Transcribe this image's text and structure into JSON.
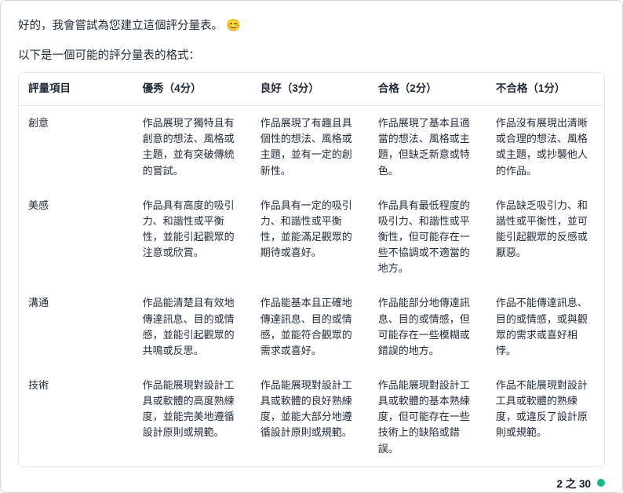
{
  "intro": "好的，我會嘗試為您建立這個評分量表。",
  "intro_emoji": "😊",
  "subtitle": "以下是一個可能的評分量表的格式：",
  "table": {
    "headers": {
      "item": "評量項目",
      "l4": "優秀（4分）",
      "l3": "良好（3分）",
      "l2": "合格（2分）",
      "l1": "不合格（1分）"
    },
    "rows": [
      {
        "name": "創意",
        "l4": "作品展現了獨特且有創意的想法、風格或主題，並有突破傳統的嘗試。",
        "l3": "作品展現了有趣且具個性的想法、風格或主題，並有一定的創新性。",
        "l2": "作品展現了基本且適當的想法、風格或主題，但缺乏新意或特色。",
        "l1": "作品沒有展現出清晰或合理的想法、風格或主題，或抄襲他人的作品。"
      },
      {
        "name": "美感",
        "l4": "作品具有高度的吸引力、和諧性或平衡性，並能引起觀眾的注意或欣賞。",
        "l3": "作品具有一定的吸引力、和諧性或平衡性，並能滿足觀眾的期待或喜好。",
        "l2": "作品具有最低程度的吸引力、和諧性或平衡性，但可能存在一些不協調或不適當的地方。",
        "l1": "作品缺乏吸引力、和諧性或平衡性，並可能引起觀眾的反感或厭惡。"
      },
      {
        "name": "溝通",
        "l4": "作品能清楚且有效地傳達訊息、目的或情感，並能引起觀眾的共鳴或反思。",
        "l3": "作品能基本且正確地傳達訊息、目的或情感，並能符合觀眾的需求或喜好。",
        "l2": "作品能部分地傳達訊息、目的或情感，但可能存在一些模糊或錯誤的地方。",
        "l1": "作品不能傳達訊息、目的或情感，或與觀眾的需求或喜好相悖。"
      },
      {
        "name": "技術",
        "l4": "作品能展現對設計工具或軟體的高度熟練度，並能完美地遵循設計原則或規範。",
        "l3": "作品能展現對設計工具或軟體的良好熟練度，並能大部分地遵循設計原則或規範。",
        "l2": "作品能展現對設計工具或軟體的基本熟練度，但可能存在一些技術上的缺陷或錯誤。",
        "l1": "作品不能展現對設計工具或軟體的熟練度，或違反了設計原則或規範。"
      }
    ]
  },
  "footer": {
    "page_text": "2 之 30",
    "status_color": "#10b981"
  }
}
